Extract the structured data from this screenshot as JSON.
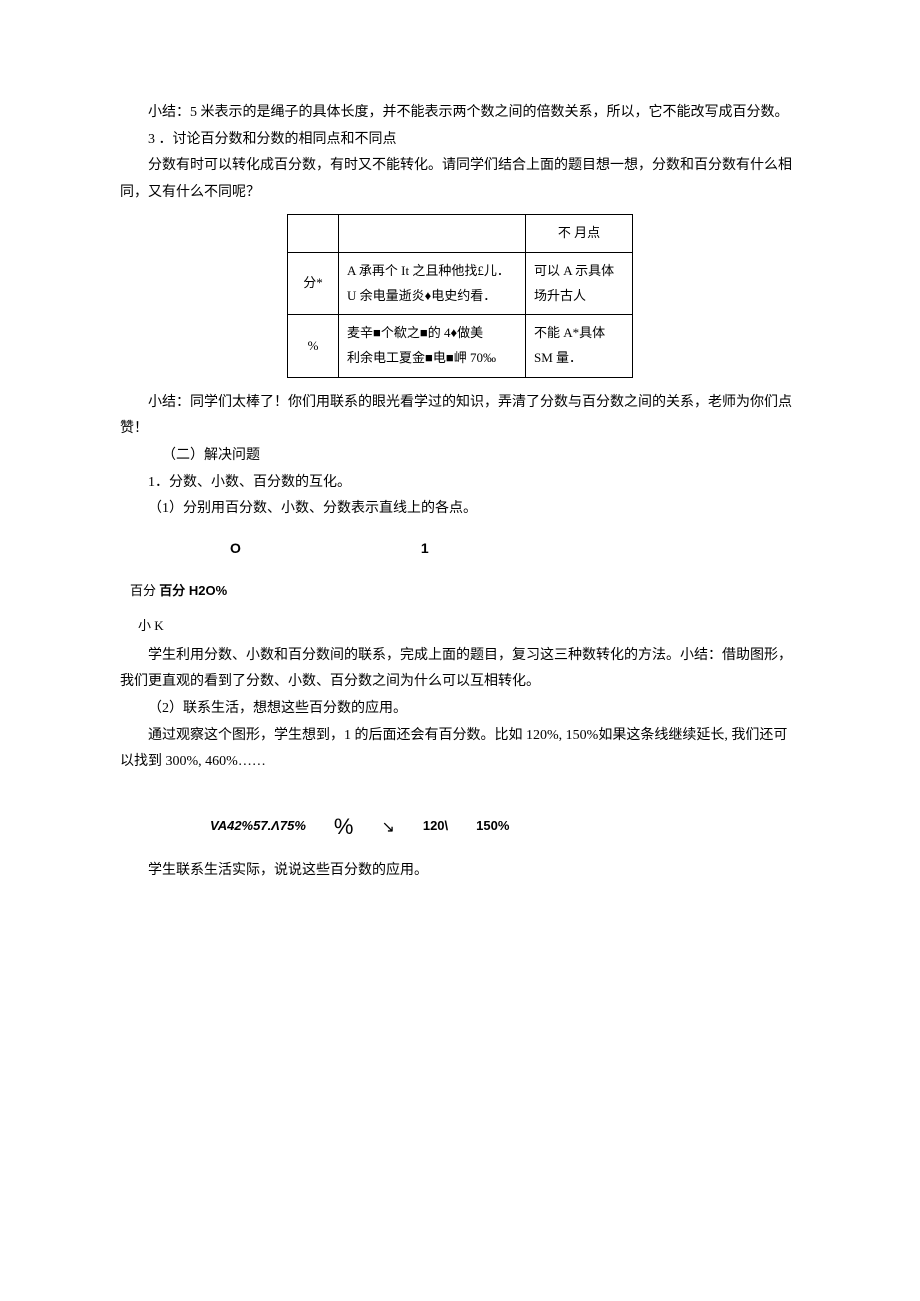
{
  "p1": "小结：5 米表示的是绳子的具体长度，并不能表示两个数之间的倍数关系，所以，它不能改写成百分数。",
  "p2": "3 ．讨论百分数和分数的相同点和不同点",
  "p3": "分数有时可以转化成百分数，有时又不能转化。请同学们结合上面的题目想一想，分数和百分数有什么相同，又有什么不同呢？",
  "table": {
    "r1c1": "",
    "r1c2": "",
    "r1c3": "不 月点",
    "r2c1": "分*",
    "r2c2": "A 承再个 It 之且种他找£儿．\nU 余电量逝炎♦电史约看．",
    "r2c3": "可以 A 示具体\n场升古人",
    "r3c1": "%",
    "r3c2": "麦辛■个欷之■的 4♦做美\n利余电工夏金■电■岬 70‰",
    "r3c3": "不能 A*具体\nSM 量．"
  },
  "p4": "小结：同学们太棒了！你们用联系的眼光看学过的知识，弄清了分数与百分数之间的关系，老师为你们点赞！",
  "p5": "（二）解决问题",
  "p6": "1．分数、小数、百分数的互化。",
  "p7": "（1）分别用百分数、小数、分数表示直线上的各点。",
  "axis": {
    "a": "O",
    "b": "1"
  },
  "label1": "百分 H2O%",
  "label2": "小 K",
  "p8": "学生利用分数、小数和百分数间的联系，完成上面的题目，复习这三种数转化的方法。小结：借助图形，我们更直观的看到了分数、小数、百分数之间为什么可以互相转化。",
  "p9": "（2）联系生活，想想这些百分数的应用。",
  "p10": "通过观察这个图形，学生想到，1 的后面还会有百分数。比如 120%, 150%如果这条线继续延长, 我们还可以找到 300%, 460%……",
  "nums": {
    "a": "VA42%57.Λ75%",
    "b": "%",
    "c": "120\\",
    "d": "150%"
  },
  "p11": "学生联系生活实际，说说这些百分数的应用。"
}
